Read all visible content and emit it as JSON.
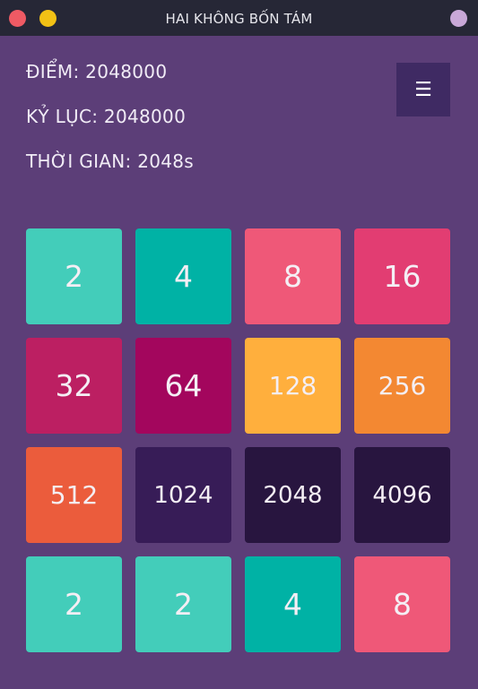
{
  "window": {
    "title": "HAI KHÔNG BỐN TÁM"
  },
  "stats": {
    "score": "ĐIỂM: 2048000",
    "best": "KỶ LỤC: 2048000",
    "time": "THỜI GIAN: 2048s"
  },
  "menu": {
    "icon": "☰",
    "icon_name": "hamburger-menu-icon"
  },
  "board": {
    "rows": [
      [
        "2",
        "4",
        "8",
        "16"
      ],
      [
        "32",
        "64",
        "128",
        "256"
      ],
      [
        "512",
        "1024",
        "2048",
        "4096"
      ],
      [
        "2",
        "2",
        "4",
        "8"
      ]
    ]
  },
  "colors": {
    "background": "#5c3e78",
    "titlebar": "#262736",
    "menu_button": "#3f2a63",
    "tile_text": "#f4eef4",
    "tile_2": "#43cdba",
    "tile_4": "#00b2a5",
    "tile_8": "#ef5878",
    "tile_16": "#e23d72",
    "tile_32": "#bc1f62",
    "tile_64": "#a3065d",
    "tile_128": "#ffaf3d",
    "tile_256": "#f38832",
    "tile_512": "#eb5c3c",
    "tile_1024": "#371c57",
    "tile_2048": "#28153f",
    "tile_4096": "#28153f"
  }
}
